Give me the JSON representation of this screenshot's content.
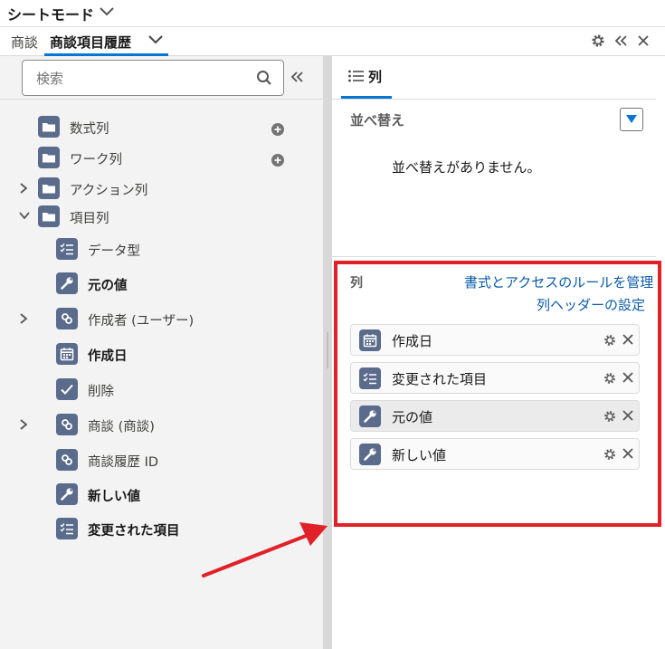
{
  "header": {
    "title": "シートモード"
  },
  "tabs": {
    "object_label": "商談",
    "active_label": "商談項目履歴"
  },
  "left": {
    "search_placeholder": "検索",
    "items": [
      {
        "label": "数式列",
        "icon": "folder-icon",
        "bold": false
      },
      {
        "label": "ワーク列",
        "icon": "folder-icon",
        "bold": false
      },
      {
        "label": "アクション列",
        "icon": "folder-icon",
        "bold": false
      },
      {
        "label": "項目列",
        "icon": "folder-open-icon",
        "bold": false
      },
      {
        "label": "データ型",
        "icon": "picklist-icon",
        "bold": false
      },
      {
        "label": "元の値",
        "icon": "wrench-icon",
        "bold": true
      },
      {
        "label": "作成者 (ユーザー)",
        "icon": "lookup-icon",
        "bold": false
      },
      {
        "label": "作成日",
        "icon": "calendar-icon",
        "bold": true
      },
      {
        "label": "削除",
        "icon": "checkbox-icon",
        "bold": false
      },
      {
        "label": "商談 (商談)",
        "icon": "lookup-icon",
        "bold": false
      },
      {
        "label": "商談履歴 ID",
        "icon": "lookup-icon",
        "bold": false
      },
      {
        "label": "新しい値",
        "icon": "wrench-icon",
        "bold": true
      },
      {
        "label": "変更された項目",
        "icon": "picklist-icon",
        "bold": true
      }
    ]
  },
  "right": {
    "tab_label": "列",
    "sort": {
      "title": "並べ替え",
      "empty_text": "並べ替えがありません。"
    },
    "columns": {
      "title": "列",
      "link_manage": "書式とアクセスのルールを管理",
      "link_header": "列ヘッダーの設定",
      "items": [
        {
          "label": "作成日",
          "icon": "calendar-icon"
        },
        {
          "label": "変更された項目",
          "icon": "picklist-icon"
        },
        {
          "label": "元の値",
          "icon": "wrench-icon"
        },
        {
          "label": "新しい値",
          "icon": "wrench-icon"
        }
      ]
    }
  },
  "colors": {
    "accent": "#0176d3",
    "link": "#0b5cab",
    "highlight_border": "#e12127",
    "icon_bg": "#5a6b8c"
  }
}
